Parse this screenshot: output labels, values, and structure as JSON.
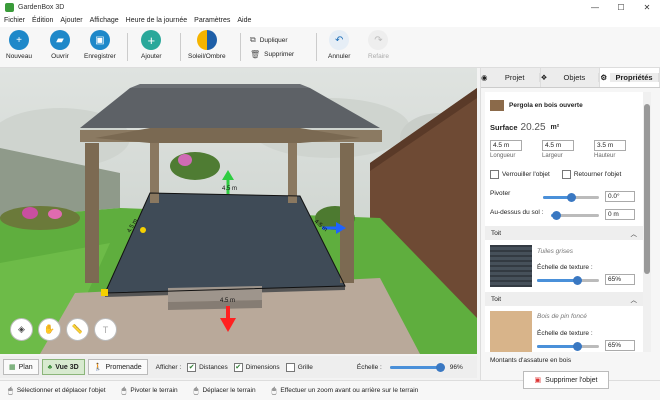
{
  "app": {
    "title": "GardenBox 3D"
  },
  "menu": [
    "Fichier",
    "Édition",
    "Ajouter",
    "Affichage",
    "Heure de la journée",
    "Paramètres",
    "Aide"
  ],
  "toolbar": {
    "new": "Nouveau",
    "open": "Ouvrir",
    "save": "Enregistrer",
    "add": "Ajouter",
    "sun": "Soleil/Ombre",
    "duplicate": "Dupliquer",
    "delete": "Supprimer",
    "undo": "Annuler",
    "redo": "Refaire"
  },
  "viewport": {
    "dim_front": "4.5 m",
    "dim_side": "4.5 m",
    "dim_left": "4.5 m",
    "dim_bottom": "4.5 m"
  },
  "view": {
    "plan": "Plan",
    "view3d": "Vue 3D",
    "walk": "Promenade",
    "show": "Afficher :",
    "distances": "Distances",
    "dimensions": "Dimensions",
    "grid": "Grille",
    "scale_label": "Échelle :",
    "scale_value": "96%",
    "scale_fraction": 0.96
  },
  "status": {
    "select": "Sélectionner et déplacer l'objet",
    "rotate": "Pivoter le terrain",
    "move": "Déplacer le terrain",
    "zoom": "Effectuer un zoom avant ou arrière sur le terrain"
  },
  "panel": {
    "tabs": [
      "Projet",
      "Objets",
      "Propriétés"
    ],
    "object_name": "Pergola en bois ouverte",
    "surface_label": "Surface",
    "surface_value": "20.25",
    "surface_unit": "m²",
    "length_value": "4.5 m",
    "width_value": "4.5 m",
    "height_value": "3.5 m",
    "length_label": "Longueur",
    "width_label": "Largeur",
    "height_label": "Hauteur",
    "lock": "Verrouiller l'objet",
    "flip": "Retourner l'objet",
    "rotate_label": "Pivoter",
    "rotate_value": "0.0°",
    "rotate_fraction": 0.5,
    "above_label": "Au-dessus du sol :",
    "above_value": "0 m",
    "above_fraction": 0.1,
    "roof1_header": "Toit",
    "roof1_texture": "Tuiles grises",
    "roof1_scale_label": "Échelle de texture :",
    "roof1_scale_value": "65%",
    "roof1_fraction": 0.65,
    "roof2_header": "Toit",
    "roof2_texture": "Bois de pin foncé",
    "roof2_scale_label": "Échelle de texture :",
    "roof2_scale_value": "65%",
    "roof2_fraction": 0.65,
    "next_section": "Montants d'assature en bois",
    "delete_button": "Supprimer l'objet"
  },
  "colors": {
    "accent": "#1e88c9",
    "green": "#3aa655",
    "delete": "#d33"
  }
}
